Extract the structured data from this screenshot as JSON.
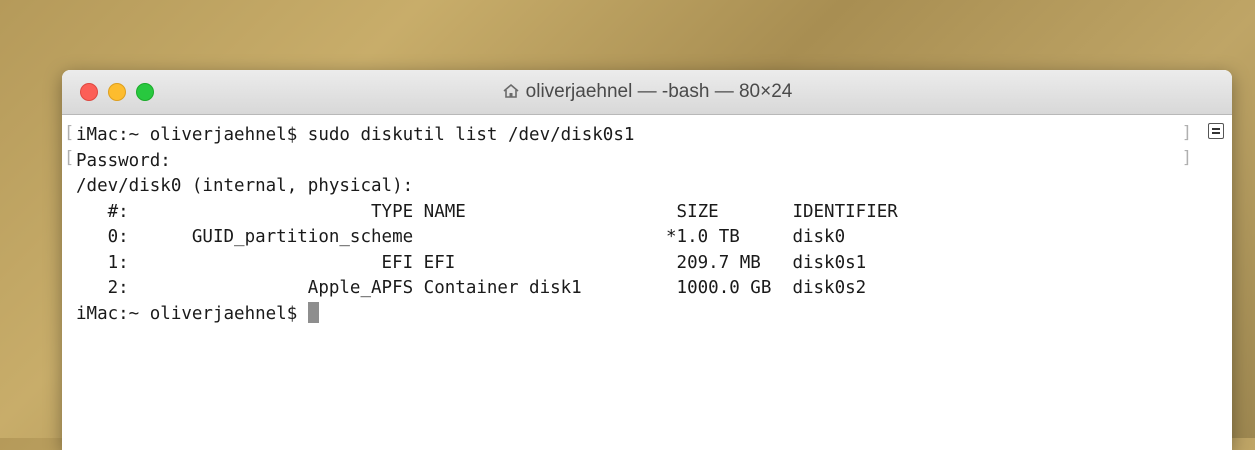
{
  "window": {
    "title": "oliverjaehnel — -bash — 80×24",
    "title_icon": "home-icon"
  },
  "terminal": {
    "lines": [
      "iMac:~ oliverjaehnel$ sudo diskutil list /dev/disk0s1",
      "Password:",
      "/dev/disk0 (internal, physical):",
      "   #:                       TYPE NAME                    SIZE       IDENTIFIER",
      "   0:      GUID_partition_scheme                        *1.0 TB     disk0",
      "   1:                        EFI EFI                     209.7 MB   disk0s1",
      "   2:                 Apple_APFS Container disk1         1000.0 GB  disk0s2",
      "iMac:~ oliverjaehnel$ "
    ]
  },
  "colors": {
    "close": "#fc5f57",
    "minimize": "#fdbc2e",
    "zoom": "#28c83f"
  }
}
